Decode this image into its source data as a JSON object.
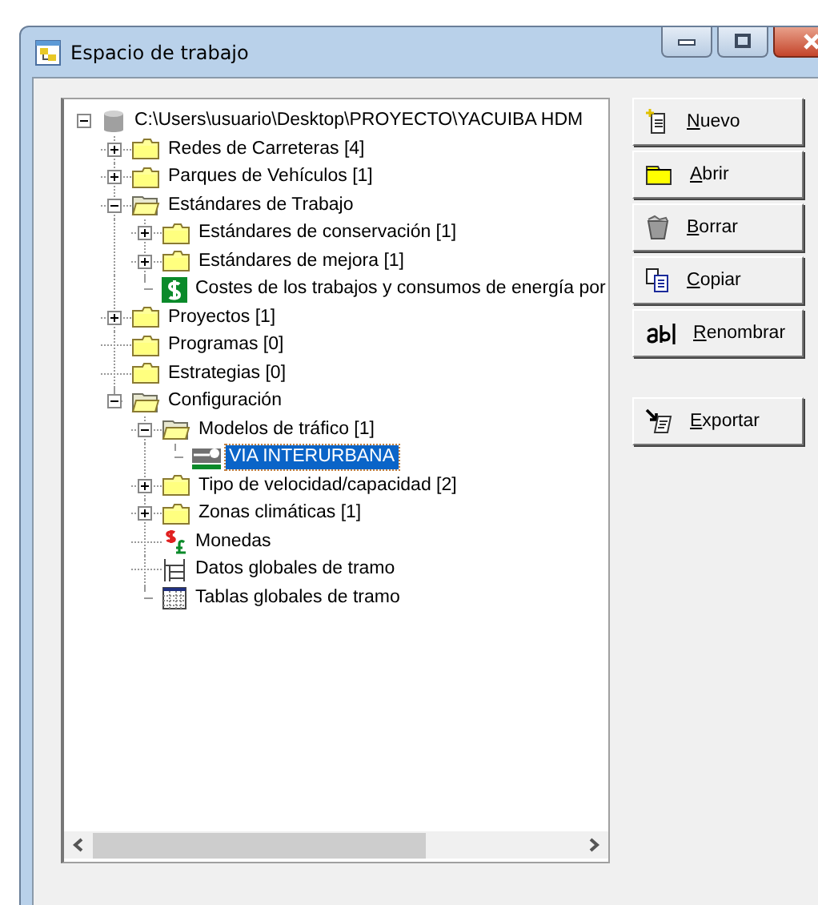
{
  "window": {
    "title": "Espacio de trabajo"
  },
  "tree": [
    {
      "label": "C:\\Users\\usuario\\Desktop\\PROYECTO\\YACUIBA HDM",
      "kind": "database",
      "expanded": true,
      "selected": false,
      "children": [
        {
          "label": "Redes de Carreteras [4]",
          "kind": "folder",
          "expanded": false,
          "selected": false
        },
        {
          "label": "Parques de Vehículos [1]",
          "kind": "folder",
          "expanded": false,
          "selected": false
        },
        {
          "label": "Estándares de Trabajo",
          "kind": "folder",
          "expanded": true,
          "selected": false,
          "children": [
            {
              "label": "Estándares de conservación [1]",
              "kind": "folder",
              "expanded": false,
              "selected": false
            },
            {
              "label": "Estándares de mejora [1]",
              "kind": "folder",
              "expanded": false,
              "selected": false
            },
            {
              "label": "Costes de los trabajos y consumos de energía por",
              "kind": "dollar",
              "selected": false
            }
          ]
        },
        {
          "label": "Proyectos [1]",
          "kind": "folder",
          "expanded": false,
          "selected": false
        },
        {
          "label": "Programas [0]",
          "kind": "folder",
          "selected": false
        },
        {
          "label": "Estrategias [0]",
          "kind": "folder",
          "selected": false
        },
        {
          "label": "Configuración",
          "kind": "folder",
          "expanded": true,
          "selected": false,
          "children": [
            {
              "label": "Modelos de tráfico [1]",
              "kind": "folder",
              "expanded": true,
              "selected": false,
              "children": [
                {
                  "label": "VIA INTERURBANA",
                  "kind": "traffic",
                  "selected": true
                }
              ]
            },
            {
              "label": "Tipo de velocidad/capacidad [2]",
              "kind": "folder",
              "expanded": false,
              "selected": false
            },
            {
              "label": "Zonas climáticas [1]",
              "kind": "folder",
              "expanded": false,
              "selected": false
            },
            {
              "label": "Monedas",
              "kind": "currency",
              "selected": false
            },
            {
              "label": "Datos globales de tramo",
              "kind": "data",
              "selected": false
            },
            {
              "label": "Tablas globales de tramo",
              "kind": "table",
              "selected": false
            }
          ]
        }
      ]
    }
  ],
  "buttons": [
    {
      "label": "Nuevo",
      "kind": "new"
    },
    {
      "label": "Abrir",
      "kind": "open"
    },
    {
      "label": "Borrar",
      "kind": "delete"
    },
    {
      "label": "Copiar",
      "kind": "copy"
    },
    {
      "label": "Renombrar",
      "kind": "rename"
    },
    {
      "label": "Exportar",
      "kind": "export"
    }
  ]
}
